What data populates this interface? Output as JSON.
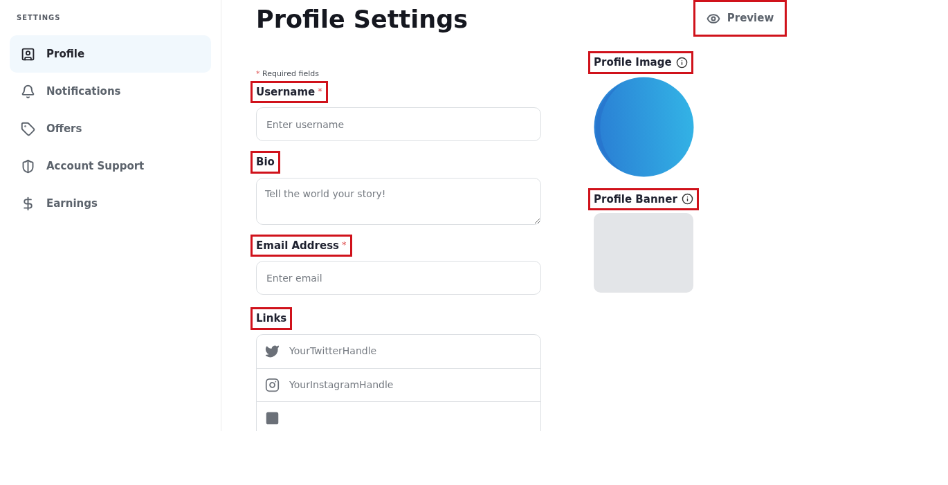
{
  "sidebar": {
    "heading": "SETTINGS",
    "items": [
      {
        "label": "Profile",
        "selected": true
      },
      {
        "label": "Notifications",
        "selected": false
      },
      {
        "label": "Offers",
        "selected": false
      },
      {
        "label": "Account Support",
        "selected": false
      },
      {
        "label": "Earnings",
        "selected": false
      }
    ]
  },
  "title": "Profile Settings",
  "preview_button": {
    "label": "Preview",
    "highlighted": true
  },
  "required_note": {
    "mark": "*",
    "text": "Required fields"
  },
  "fields": [
    {
      "kind": "input",
      "label": "Username",
      "required": true,
      "highlighted": true,
      "placeholder": "Enter username"
    },
    {
      "kind": "textarea",
      "label": "Bio",
      "required": false,
      "highlighted": true,
      "placeholder": "Tell the world your story!"
    },
    {
      "kind": "input",
      "label": "Email Address",
      "required": true,
      "highlighted": true,
      "placeholder": "Enter email"
    }
  ],
  "links": {
    "label": "Links",
    "highlighted": true,
    "items": [
      {
        "kind": "link",
        "placeholder": "YourTwitterHandle"
      },
      {
        "kind": "link",
        "placeholder": "YourInstagramHandle"
      },
      {
        "kind": "link"
      }
    ]
  },
  "profile_image": {
    "label": "Profile Image",
    "highlighted": true
  },
  "profile_banner": {
    "label": "Profile Banner",
    "highlighted": true
  }
}
